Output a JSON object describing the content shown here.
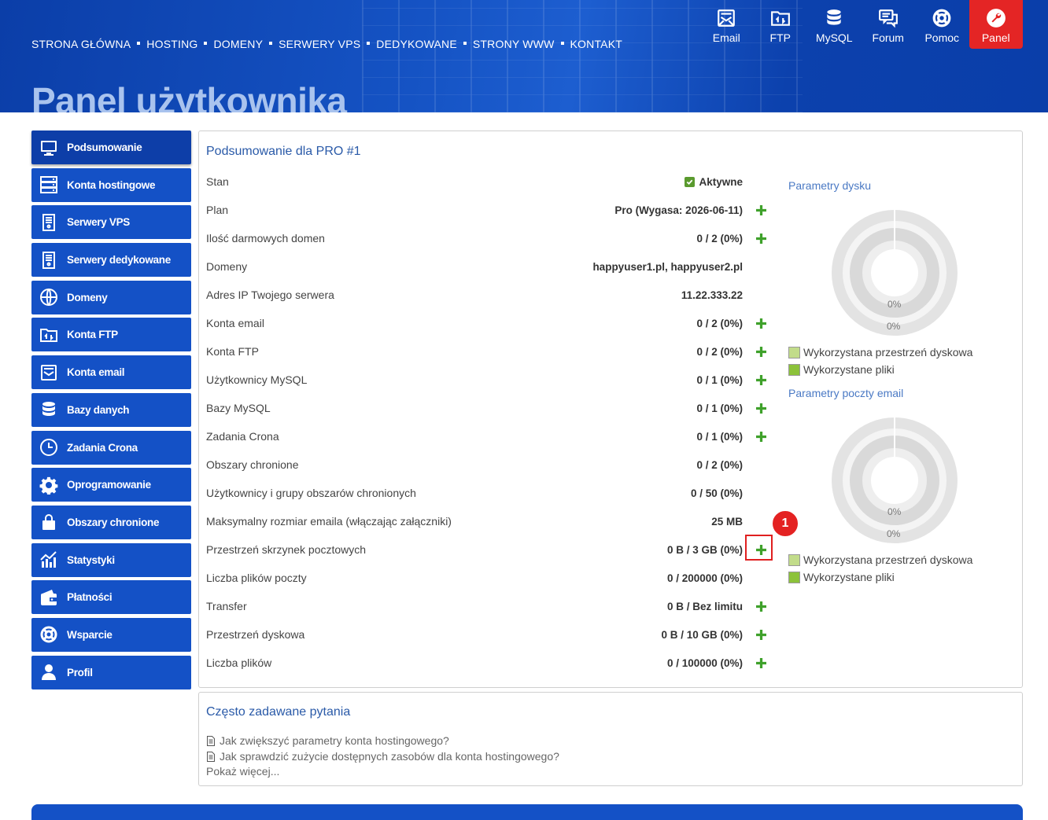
{
  "header": {
    "nav": [
      "STRONA GŁÓWNA",
      "HOSTING",
      "DOMENY",
      "SERWERY VPS",
      "DEDYKOWANE",
      "STRONY WWW",
      "KONTAKT"
    ],
    "title": "Panel użytkownika",
    "icons": [
      {
        "label": "Email",
        "icon": "email-icon"
      },
      {
        "label": "FTP",
        "icon": "ftp-folder-icon"
      },
      {
        "label": "MySQL",
        "icon": "database-icon"
      },
      {
        "label": "Forum",
        "icon": "forum-icon"
      },
      {
        "label": "Pomoc",
        "icon": "lifebuoy-icon"
      },
      {
        "label": "Panel",
        "icon": "wrench-icon"
      }
    ]
  },
  "sidebar": {
    "items": [
      {
        "label": "Podsumowanie",
        "icon": "monitor-icon"
      },
      {
        "label": "Konta hostingowe",
        "icon": "server-rack-icon"
      },
      {
        "label": "Serwery VPS",
        "icon": "server-icon"
      },
      {
        "label": "Serwery dedykowane",
        "icon": "server-icon"
      },
      {
        "label": "Domeny",
        "icon": "www-globe-icon"
      },
      {
        "label": "Konta FTP",
        "icon": "ftp-folder-icon"
      },
      {
        "label": "Konta email",
        "icon": "email-icon"
      },
      {
        "label": "Bazy danych",
        "icon": "database-icon"
      },
      {
        "label": "Zadania Crona",
        "icon": "clock-icon"
      },
      {
        "label": "Oprogramowanie",
        "icon": "gear-icon"
      },
      {
        "label": "Obszary chronione",
        "icon": "lock-icon"
      },
      {
        "label": "Statystyki",
        "icon": "chart-icon"
      },
      {
        "label": "Płatności",
        "icon": "wallet-icon"
      },
      {
        "label": "Wsparcie",
        "icon": "lifebuoy-icon"
      },
      {
        "label": "Profil",
        "icon": "user-icon"
      }
    ]
  },
  "summary": {
    "title": "Podsumowanie dla PRO #1",
    "rows": [
      {
        "label": "Stan",
        "value": "Aktywne",
        "plus": false,
        "check": true
      },
      {
        "label": "Plan",
        "value": "Pro (Wygasa: 2026-06-11)",
        "plus": true
      },
      {
        "label": "Ilość darmowych domen",
        "value": "0 / 2 (0%)",
        "plus": true
      },
      {
        "label": "Domeny",
        "value": "happyuser1.pl, happyuser2.pl",
        "plus": false
      },
      {
        "label": "Adres IP Twojego serwera",
        "value": "11.22.333.22",
        "plus": false
      },
      {
        "label": "Konta email",
        "value": "0 / 2 (0%)",
        "plus": true
      },
      {
        "label": "Konta FTP",
        "value": "0 / 2 (0%)",
        "plus": true
      },
      {
        "label": "Użytkownicy MySQL",
        "value": "0 / 1 (0%)",
        "plus": true
      },
      {
        "label": "Bazy MySQL",
        "value": "0 / 1 (0%)",
        "plus": true
      },
      {
        "label": "Zadania Crona",
        "value": "0 / 1 (0%)",
        "plus": true
      },
      {
        "label": "Obszary chronione",
        "value": "0 / 2 (0%)",
        "plus": false
      },
      {
        "label": "Użytkownicy i grupy obszarów chronionych",
        "value": "0 / 50 (0%)",
        "plus": false
      },
      {
        "label": "Maksymalny rozmiar emaila (włączając załączniki)",
        "value": "25 MB",
        "plus": false
      },
      {
        "label": "Przestrzeń skrzynek pocztowych",
        "value": "0 B / 3 GB (0%)",
        "plus": true
      },
      {
        "label": "Liczba plików poczty",
        "value": "0 / 200000 (0%)",
        "plus": false
      },
      {
        "label": "Transfer",
        "value": "0 B / Bez limitu",
        "plus": true
      },
      {
        "label": "Przestrzeń dyskowa",
        "value": "0 B / 10 GB (0%)",
        "plus": true
      },
      {
        "label": "Liczba plików",
        "value": "0 / 100000 (0%)",
        "plus": true
      }
    ],
    "callout": "1"
  },
  "charts": {
    "disk": {
      "title": "Parametry dysku",
      "inner_pct": "0%",
      "outer_pct": "0%",
      "legend": [
        "Wykorzystana przestrzeń dyskowa",
        "Wykorzystane pliki"
      ]
    },
    "mail": {
      "title": "Parametry poczty email",
      "inner_pct": "0%",
      "outer_pct": "0%",
      "legend": [
        "Wykorzystana przestrzeń dyskowa",
        "Wykorzystane pliki"
      ]
    },
    "colors": {
      "legend_light": "#c2dc8a",
      "legend_dark": "#8cc23a",
      "accent": "#1451c6",
      "danger": "#e42525"
    }
  },
  "faq": {
    "title": "Często zadawane pytania",
    "links": [
      "Jak zwiększyć parametry konta hostingowego?",
      "Jak sprawdzić zużycie dostępnych zasobów dla konta hostingowego?"
    ],
    "more": "Pokaż więcej..."
  }
}
